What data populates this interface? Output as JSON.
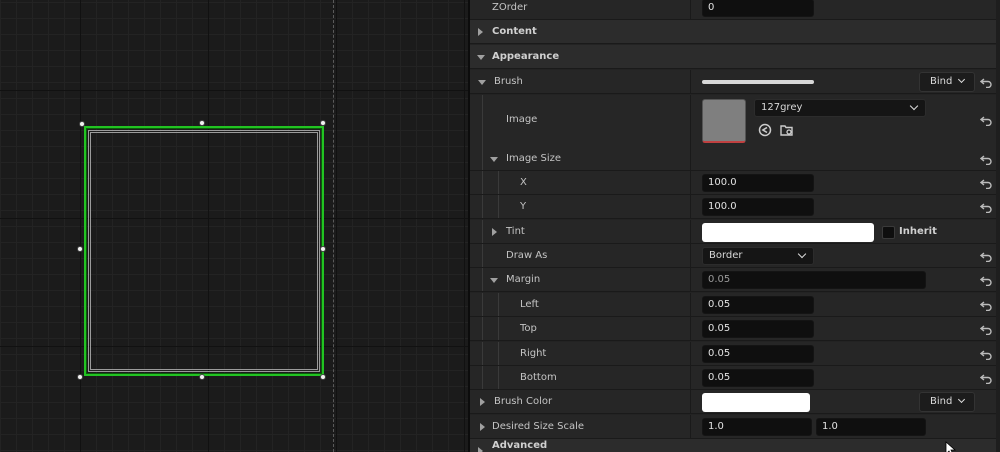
{
  "details": {
    "zorder": {
      "label": "ZOrder",
      "value": "0"
    },
    "content": {
      "label": "Content"
    },
    "appearance": {
      "label": "Appearance"
    },
    "brush": {
      "label": "Brush",
      "bind_label": "Bind"
    },
    "image": {
      "label": "Image",
      "asset": "127grey"
    },
    "image_size": {
      "label": "Image Size",
      "x_label": "X",
      "x": "100.0",
      "y_label": "Y",
      "y": "100.0"
    },
    "tint": {
      "label": "Tint",
      "color": "#ffffff",
      "inherit_label": "Inherit"
    },
    "draw_as": {
      "label": "Draw As",
      "value": "Border"
    },
    "margin": {
      "label": "Margin",
      "summary": "0.05",
      "left_label": "Left",
      "left": "0.05",
      "top_label": "Top",
      "top": "0.05",
      "right_label": "Right",
      "right": "0.05",
      "bottom_label": "Bottom",
      "bottom": "0.05"
    },
    "brush_color": {
      "label": "Brush Color",
      "color": "#ffffff",
      "bind_label": "Bind"
    },
    "desired_size_scale": {
      "label": "Desired Size Scale",
      "x": "1.0",
      "y": "1.0"
    },
    "advanced": {
      "label": "Advanced"
    }
  },
  "colors": {
    "selection": "#22c322",
    "panel_bg": "#232323",
    "field_bg": "#0f0f0f"
  }
}
